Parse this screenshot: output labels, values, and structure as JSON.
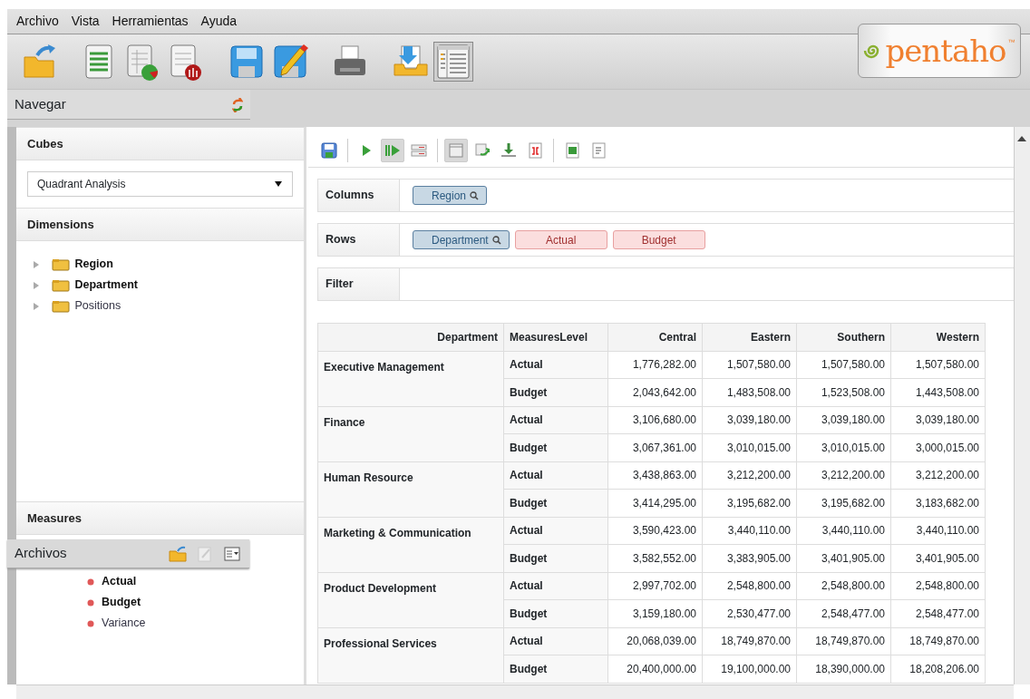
{
  "menu": [
    "Archivo",
    "Vista",
    "Herramientas",
    "Ayuda"
  ],
  "toolbar": [
    {
      "kind": "open-folder",
      "pressed": false
    },
    {
      "kind": "sheet",
      "pressed": false
    },
    {
      "kind": "sheet-chart",
      "pressed": false
    },
    {
      "kind": "sheet-report",
      "pressed": false
    },
    {
      "kind": "save",
      "pressed": false
    },
    {
      "kind": "save-edit",
      "pressed": false
    },
    {
      "kind": "print",
      "pressed": false
    },
    {
      "kind": "inbox",
      "pressed": false
    },
    {
      "kind": "list-view",
      "pressed": true
    }
  ],
  "logo": {
    "text": "pentaho",
    "mark": "™"
  },
  "navigator_panel": {
    "title": "Navegar"
  },
  "files_panel": {
    "title": "Archivos"
  },
  "cubes": {
    "title": "Cubes",
    "selected_cube": "Quadrant Analysis"
  },
  "dimensions": {
    "title": "Dimensions",
    "items": [
      {
        "label": "Region",
        "in_query": true
      },
      {
        "label": "Department",
        "in_query": true
      },
      {
        "label": "Positions",
        "in_query": false
      }
    ]
  },
  "measures": {
    "title": "Measures",
    "items": [
      {
        "label": "Actual",
        "in_query": true
      },
      {
        "label": "Budget",
        "in_query": true
      },
      {
        "label": "Variance",
        "in_query": false
      }
    ]
  },
  "query_toolbar": [
    {
      "kind": "save",
      "pressed": false
    },
    {
      "kind": "run",
      "pressed": false
    },
    {
      "kind": "auto-run",
      "pressed": true
    },
    {
      "kind": "fields",
      "pressed": false
    },
    {
      "kind": "mdx",
      "pressed": true
    },
    {
      "kind": "swap",
      "pressed": false
    },
    {
      "kind": "export",
      "pressed": false
    },
    {
      "kind": "pdf",
      "pressed": false
    },
    {
      "kind": "excel",
      "pressed": false
    },
    {
      "kind": "text",
      "pressed": false
    }
  ],
  "axes": [
    {
      "label": "Columns",
      "chips": [
        {
          "label": "Region",
          "kind": "dimension"
        }
      ]
    },
    {
      "label": "Rows",
      "chips": [
        {
          "label": "Department",
          "kind": "dimension"
        },
        {
          "label": "Actual",
          "kind": "measure"
        },
        {
          "label": "Budget",
          "kind": "measure"
        }
      ]
    },
    {
      "label": "Filter"
    }
  ],
  "table": {
    "columns": [
      "Department",
      "MeasuresLevel",
      "Central",
      "Eastern",
      "Southern",
      "Western"
    ],
    "groups": [
      {
        "department": "Executive Management",
        "rows": [
          {
            "measure": "Actual",
            "values": [
              "1,776,282.00",
              "1,507,580.00",
              "1,507,580.00",
              "1,507,580.00"
            ]
          },
          {
            "measure": "Budget",
            "values": [
              "2,043,642.00",
              "1,483,508.00",
              "1,523,508.00",
              "1,443,508.00"
            ]
          }
        ]
      },
      {
        "department": "Finance",
        "rows": [
          {
            "measure": "Actual",
            "values": [
              "3,106,680.00",
              "3,039,180.00",
              "3,039,180.00",
              "3,039,180.00"
            ]
          },
          {
            "measure": "Budget",
            "values": [
              "3,067,361.00",
              "3,010,015.00",
              "3,010,015.00",
              "3,000,015.00"
            ]
          }
        ]
      },
      {
        "department": "Human Resource",
        "rows": [
          {
            "measure": "Actual",
            "values": [
              "3,438,863.00",
              "3,212,200.00",
              "3,212,200.00",
              "3,212,200.00"
            ]
          },
          {
            "measure": "Budget",
            "values": [
              "3,414,295.00",
              "3,195,682.00",
              "3,195,682.00",
              "3,183,682.00"
            ]
          }
        ]
      },
      {
        "department": "Marketing & Communication",
        "rows": [
          {
            "measure": "Actual",
            "values": [
              "3,590,423.00",
              "3,440,110.00",
              "3,440,110.00",
              "3,440,110.00"
            ]
          },
          {
            "measure": "Budget",
            "values": [
              "3,582,552.00",
              "3,383,905.00",
              "3,401,905.00",
              "3,401,905.00"
            ]
          }
        ]
      },
      {
        "department": "Product Development",
        "rows": [
          {
            "measure": "Actual",
            "values": [
              "2,997,702.00",
              "2,548,800.00",
              "2,548,800.00",
              "2,548,800.00"
            ]
          },
          {
            "measure": "Budget",
            "values": [
              "3,159,180.00",
              "2,530,477.00",
              "2,548,477.00",
              "2,548,477.00"
            ]
          }
        ]
      },
      {
        "department": "Professional Services",
        "rows": [
          {
            "measure": "Actual",
            "values": [
              "20,068,039.00",
              "18,749,870.00",
              "18,749,870.00",
              "18,749,870.00"
            ]
          },
          {
            "measure": "Budget",
            "values": [
              "20,400,000.00",
              "19,100,000.00",
              "18,390,000.00",
              "18,208,206.00"
            ]
          }
        ]
      }
    ]
  }
}
